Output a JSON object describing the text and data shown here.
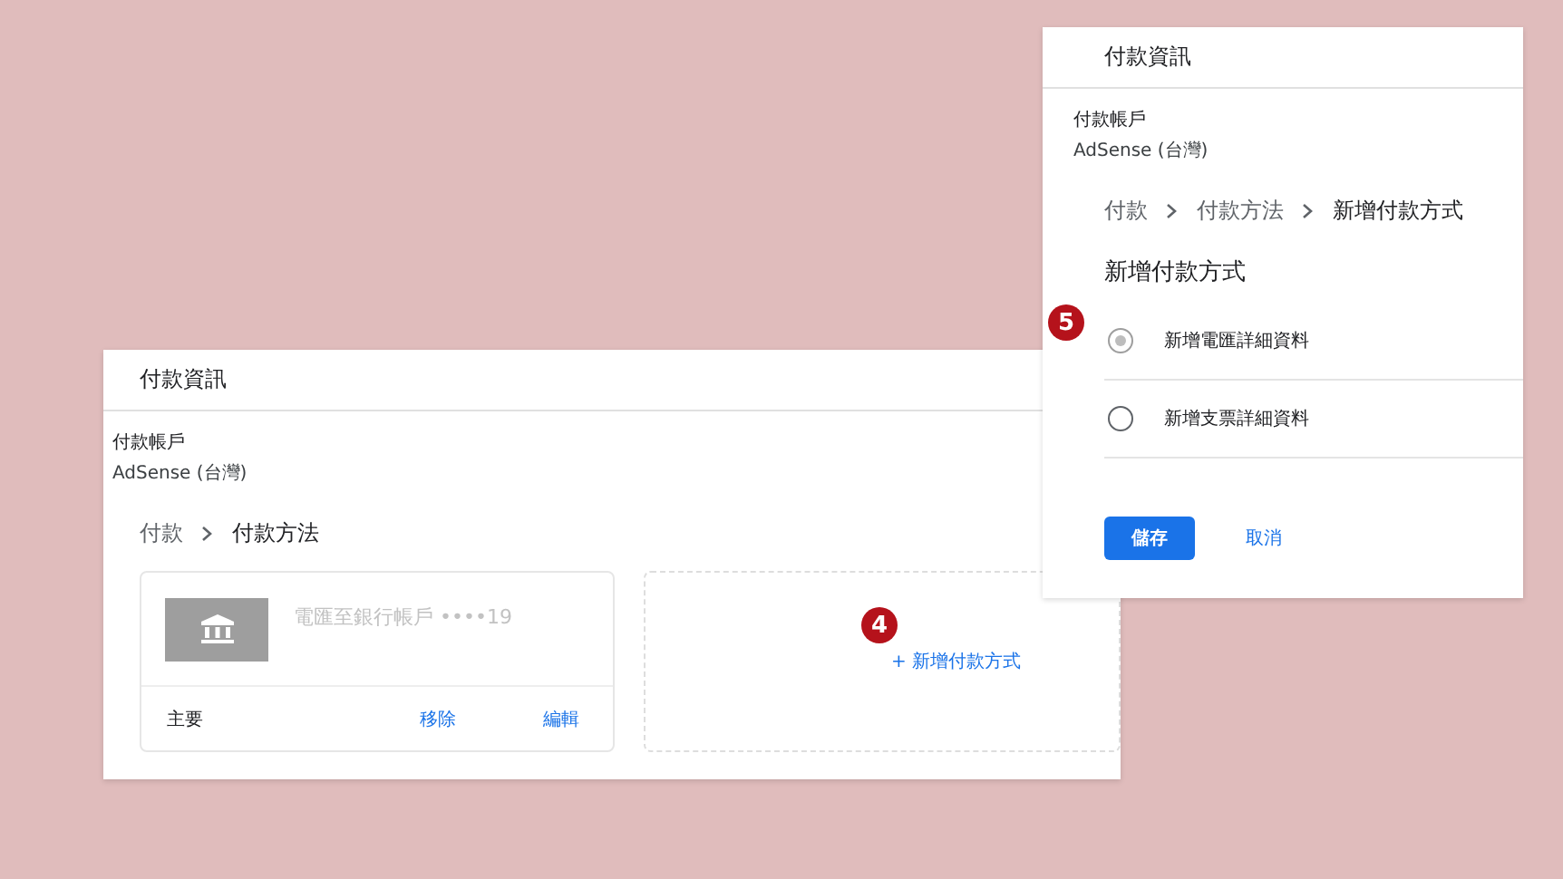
{
  "list_window": {
    "title": "付款資訊",
    "account_label": "付款帳戶",
    "account_name": "AdSense (台灣)",
    "breadcrumb": [
      "付款",
      "付款方法"
    ],
    "method_card": {
      "name": "電匯至銀行帳戶 ••••19",
      "status": "主要",
      "actions": [
        "移除",
        "編輯"
      ]
    },
    "add_link": "+ 新增付款方式",
    "step_badge": "4"
  },
  "add_window": {
    "title": "付款資訊",
    "account_label": "付款帳戶",
    "account_name": "AdSense (台灣)",
    "breadcrumb": [
      "付款",
      "付款方法",
      "新增付款方式"
    ],
    "heading": "新增付款方式",
    "options": [
      {
        "label": "新增電匯詳細資料",
        "selected": true
      },
      {
        "label": "新增支票詳細資料",
        "selected": false
      }
    ],
    "save": "儲存",
    "cancel": "取消",
    "step_badge": "5"
  }
}
